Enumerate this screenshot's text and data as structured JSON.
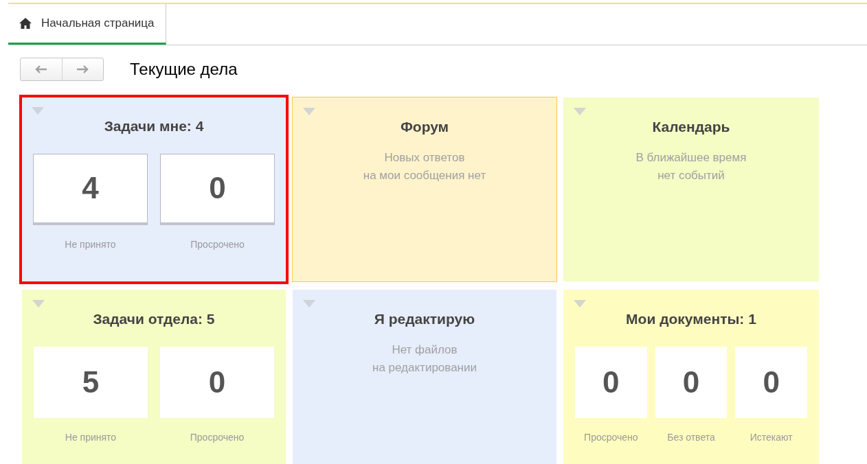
{
  "tabs": [
    {
      "label": "Начальная страница",
      "selected": true
    }
  ],
  "page_title": "Текущие дела",
  "cards": [
    {
      "kind": "counters",
      "title": "Задачи мне: 4",
      "color": "#e6edfb",
      "selected": true,
      "hovered": false,
      "counters": [
        {
          "value": "4",
          "label": "Не принято"
        },
        {
          "value": "0",
          "label": "Просрочено"
        }
      ]
    },
    {
      "kind": "message",
      "title": "Форум",
      "color": "#fff3cc",
      "selected": false,
      "hovered": true,
      "lines": [
        "Новых ответов",
        "на мои сообщения нет"
      ]
    },
    {
      "kind": "message",
      "title": "Календарь",
      "color": "#f5fcc4",
      "selected": false,
      "hovered": false,
      "lines": [
        "В ближайшее время",
        "нет событий"
      ]
    },
    {
      "kind": "counters",
      "title": "Задачи отдела: 5",
      "color": "#f5fcc4",
      "selected": false,
      "hovered": false,
      "counters": [
        {
          "value": "5",
          "label": "Не принято"
        },
        {
          "value": "0",
          "label": "Просрочено"
        }
      ]
    },
    {
      "kind": "message",
      "title": "Я редактирую",
      "color": "#e6edfb",
      "selected": false,
      "hovered": false,
      "lines": [
        "Нет файлов",
        "на редактировании"
      ]
    },
    {
      "kind": "counters",
      "title": "Мои документы: 1",
      "color": "#fffcc0",
      "selected": false,
      "hovered": false,
      "counters": [
        {
          "value": "0",
          "label": "Просрочено"
        },
        {
          "value": "0",
          "label": "Без ответа"
        },
        {
          "value": "0",
          "label": "Истекают"
        }
      ]
    }
  ]
}
